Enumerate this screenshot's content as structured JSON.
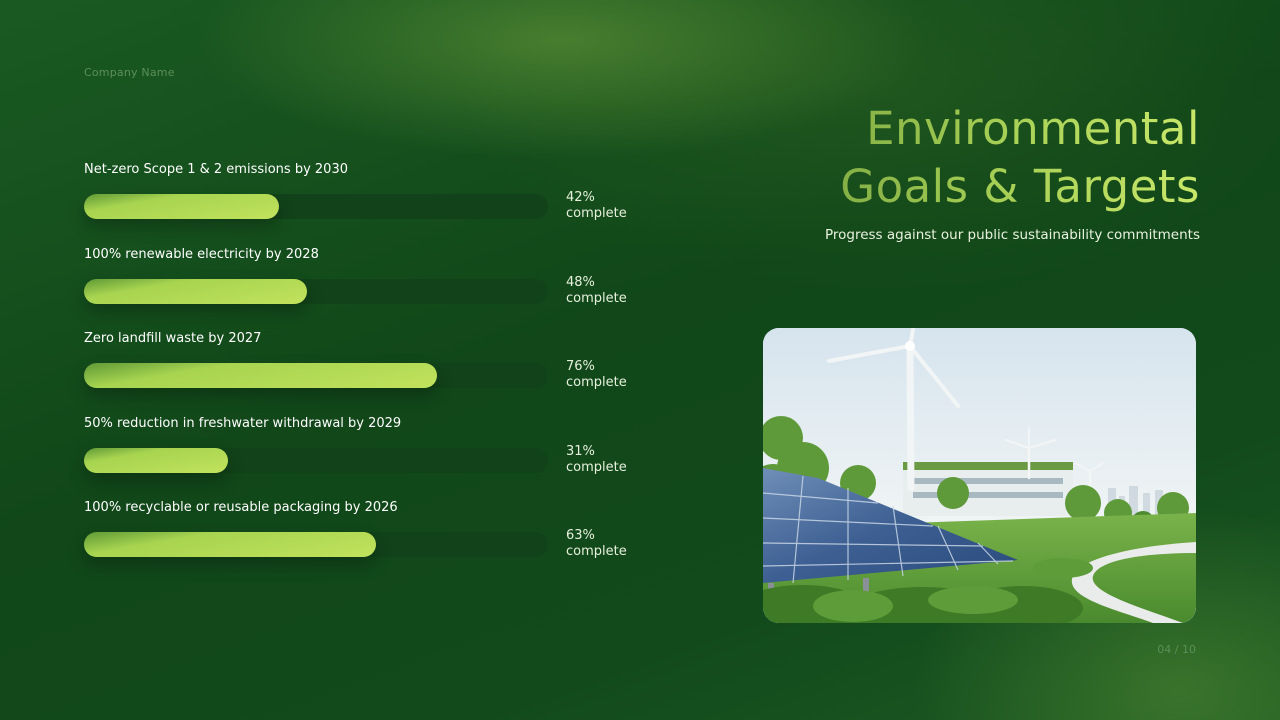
{
  "header": {
    "company": "Company Name",
    "title_line1": "Environmental",
    "title_line2": "Goals & Targets",
    "subtitle": "Progress against our public sustainability commitments"
  },
  "goals": [
    {
      "label": "Net-zero Scope 1 & 2 emissions by 2030",
      "progress": 42,
      "percent_text": "42%",
      "complete_text": "complete"
    },
    {
      "label": "100% renewable electricity by 2028",
      "progress": 48,
      "percent_text": "48%",
      "complete_text": "complete"
    },
    {
      "label": "Zero landfill waste by 2027",
      "progress": 76,
      "percent_text": "76%",
      "complete_text": "complete"
    },
    {
      "label": "50% reduction in freshwater withdrawal by 2029",
      "progress": 31,
      "percent_text": "31%",
      "complete_text": "complete"
    },
    {
      "label": "100% recyclable or reusable packaging by 2026",
      "progress": 63,
      "percent_text": "63%",
      "complete_text": "complete"
    }
  ],
  "footer": {
    "page_number": "04 / 10"
  },
  "colors": {
    "background": "#124a1c",
    "track": "#114219",
    "bar_accent": "#c2e25c",
    "title_accent": "#a8d156"
  }
}
